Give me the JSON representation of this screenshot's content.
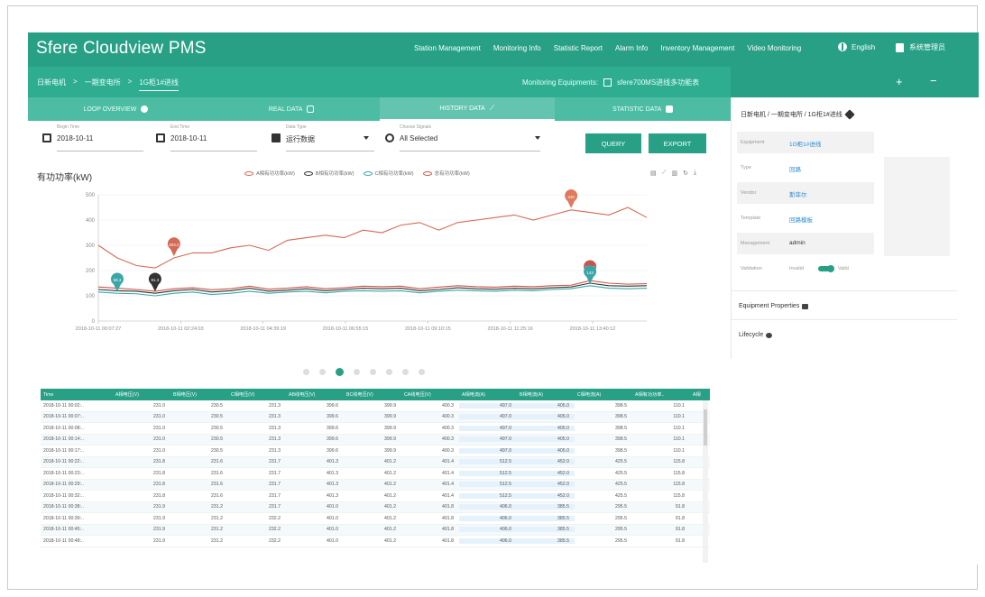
{
  "app": {
    "title": "Sfere Cloudview PMS"
  },
  "topnav": [
    "Station Management",
    "Monitoring Info",
    "Statistic Report",
    "Alarm Info",
    "Inventory Management",
    "Video Monitoring"
  ],
  "lang": {
    "label": "English"
  },
  "user": {
    "label": "系统管理员"
  },
  "breadcrumb": [
    "日新电机",
    "一期变电所",
    "1G柜1#进线"
  ],
  "monitoring": {
    "label": "Monitoring Equipments:",
    "device": "sfere700MS进线多功能表"
  },
  "tabs": [
    {
      "label": "LOOP OVERVIEW"
    },
    {
      "label": "REAL DATA"
    },
    {
      "label": "HISTORY DATA"
    },
    {
      "label": "STATISTIC DATA"
    }
  ],
  "filters": {
    "begin_label": "Begin Time",
    "begin_value": "2018-10-11",
    "end_label": "End Time",
    "end_value": "2018-10-11",
    "type_label": "Data Type",
    "type_value": "运行数据",
    "signal_label": "Choose Signals",
    "signal_value": "All Selected"
  },
  "buttons": {
    "query": "QUERY",
    "export": "EXPORT"
  },
  "chart_data": {
    "type": "line",
    "title": "有功功率(kW)",
    "ylim": [
      0,
      500
    ],
    "yticks": [
      "500",
      "400",
      "300",
      "200",
      "100",
      "0"
    ],
    "x": [
      "2018-10-11 00:07:27",
      "2018-10-11 02:24:03",
      "2018-10-11 04:39:19",
      "2018-10-11 06:55:15",
      "2018-10-11 09:10:15",
      "2018-10-11 11:25:16",
      "2018-10-11 13:40:12"
    ],
    "series": [
      {
        "name": "A相有功功率(kW)",
        "color": "#d46a55",
        "values": [
          300,
          250,
          220,
          210,
          250,
          270,
          270,
          290,
          300,
          280,
          320,
          330,
          340,
          330,
          360,
          350,
          380,
          390,
          360,
          390,
          400,
          410,
          420,
          400,
          420,
          440,
          430,
          420,
          450,
          410
        ]
      },
      {
        "name": "B相有功功率(kW)",
        "color": "#333333",
        "values": [
          125,
          120,
          118,
          110,
          120,
          125,
          115,
          120,
          130,
          118,
          122,
          128,
          120,
          125,
          130,
          128,
          130,
          120,
          125,
          132,
          128,
          126,
          130,
          128,
          132,
          135,
          150,
          140,
          138,
          140
        ]
      },
      {
        "name": "C相有功功率(kW)",
        "color": "#3aa6a8",
        "values": [
          115,
          110,
          108,
          100,
          110,
          115,
          105,
          110,
          118,
          110,
          115,
          118,
          112,
          118,
          120,
          118,
          120,
          112,
          118,
          122,
          120,
          118,
          122,
          120,
          125,
          128,
          140,
          130,
          128,
          130
        ]
      },
      {
        "name": "总有功功率(kW)",
        "color": "#c9564a",
        "values": [
          135,
          130,
          125,
          118,
          128,
          132,
          124,
          128,
          138,
          126,
          130,
          136,
          128,
          132,
          138,
          136,
          138,
          128,
          134,
          140,
          136,
          134,
          138,
          136,
          140,
          142,
          160,
          150,
          146,
          148
        ]
      }
    ],
    "markers": [
      {
        "label": "440",
        "color": "#e07a5f"
      },
      {
        "label": "203.2",
        "color": "#d46a55"
      },
      {
        "label": "91.3",
        "color": "#333333"
      },
      {
        "label": "58.3",
        "color": "#3aa6a8"
      },
      {
        "label": "155.8",
        "color": "#c9564a"
      },
      {
        "label": "143",
        "color": "#3aa6a8"
      }
    ],
    "grid": true,
    "legend": "top"
  },
  "table": {
    "columns": [
      "Time",
      "A相电压(V)",
      "B相电压(V)",
      "C相电压(V)",
      "AB线电压(V)",
      "BC线电压(V)",
      "CA线电压(V)",
      "A相电流(A)",
      "B相电流(A)",
      "C相电流(A)",
      "A相有功功率..",
      "A相"
    ],
    "rows": [
      [
        "2018-10-11 00:02:..",
        "231.0",
        "230.5",
        "231.3",
        "399.6",
        "399.9",
        "400.3",
        "497.0",
        "405.0",
        "398.5",
        "110.1"
      ],
      [
        "2018-10-11 00:07:..",
        "231.0",
        "230.5",
        "231.3",
        "399.6",
        "399.9",
        "400.3",
        "497.0",
        "405.0",
        "398.5",
        "110.1"
      ],
      [
        "2018-10-11 00:08:..",
        "231.0",
        "230.5",
        "231.3",
        "399.6",
        "399.9",
        "400.3",
        "497.0",
        "405.0",
        "398.5",
        "110.1"
      ],
      [
        "2018-10-11 00:14:..",
        "231.0",
        "230.5",
        "231.3",
        "399.6",
        "399.9",
        "400.3",
        "497.0",
        "405.0",
        "398.5",
        "110.1"
      ],
      [
        "2018-10-11 00:17:..",
        "231.0",
        "230.5",
        "231.3",
        "399.6",
        "399.9",
        "400.3",
        "497.0",
        "405.0",
        "398.5",
        "110.1"
      ],
      [
        "2018-10-11 00:22:..",
        "231.8",
        "231.6",
        "231.7",
        "401.3",
        "401.2",
        "401.4",
        "512.5",
        "452.0",
        "425.5",
        "115.8"
      ],
      [
        "2018-10-11 00:23:..",
        "231.8",
        "231.6",
        "231.7",
        "401.3",
        "401.2",
        "401.4",
        "512.5",
        "452.0",
        "425.5",
        "115.8"
      ],
      [
        "2018-10-11 00:29:..",
        "231.8",
        "231.6",
        "231.7",
        "401.3",
        "401.2",
        "401.4",
        "512.5",
        "452.0",
        "425.5",
        "115.8"
      ],
      [
        "2018-10-11 00:32:..",
        "231.8",
        "231.6",
        "231.7",
        "401.3",
        "401.2",
        "401.4",
        "512.5",
        "452.0",
        "425.5",
        "115.8"
      ],
      [
        "2018-10-11 00:38:..",
        "231.9",
        "231.2",
        "231.7",
        "401.0",
        "401.2",
        "401.8",
        "406.0",
        "385.5",
        "295.5",
        "91.8"
      ],
      [
        "2018-10-11 00:39:..",
        "231.9",
        "231.2",
        "232.2",
        "401.0",
        "401.2",
        "401.8",
        "406.0",
        "385.5",
        "295.5",
        "91.8"
      ],
      [
        "2018-10-11 00:45:..",
        "231.9",
        "231.2",
        "232.2",
        "401.0",
        "401.2",
        "401.8",
        "406.0",
        "385.5",
        "295.5",
        "91.8"
      ],
      [
        "2018-10-11 00:48:..",
        "231.9",
        "231.2",
        "232.2",
        "401.0",
        "401.2",
        "401.8",
        "406.0",
        "385.5",
        "295.5",
        "91.8"
      ]
    ]
  },
  "pagination": {
    "count": 8,
    "active": 3
  },
  "panel": {
    "path": "日新电机 / 一期变电所 / 1G柜1#进线",
    "fields": [
      {
        "key": "Equipment",
        "value": "1G柜1#进线"
      },
      {
        "key": "Type",
        "value": "回路"
      },
      {
        "key": "Vendor",
        "value": "斯菲尔"
      },
      {
        "key": "Template",
        "value": "回路模板"
      },
      {
        "key": "Management",
        "value": "admin"
      }
    ],
    "validation": {
      "key": "Validation",
      "off": "Invalid",
      "on": "Valid"
    },
    "properties": "Equipment Properties",
    "lifecycle": "Lifecycle"
  },
  "colors": {
    "brand": "#27a085",
    "brand_light": "#4cbca3",
    "link": "#2c8cd1"
  }
}
